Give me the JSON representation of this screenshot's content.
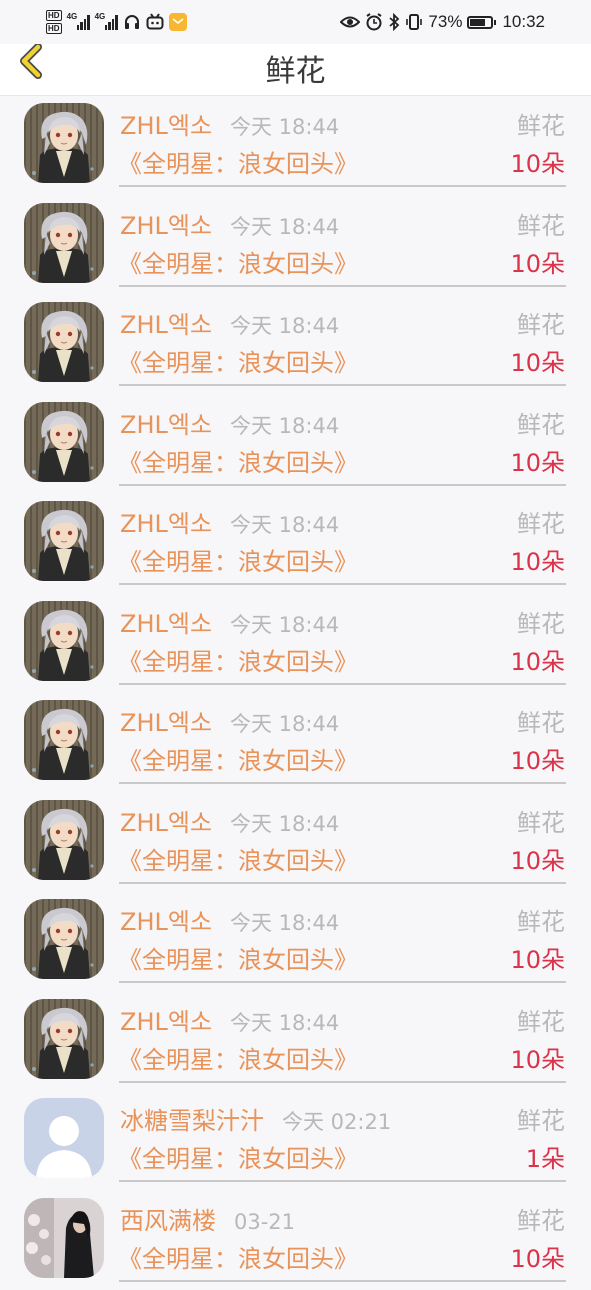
{
  "status_bar": {
    "hd1": "HD",
    "hd2": "HD",
    "net1": "4G",
    "net2": "4G",
    "battery_text": "73%",
    "battery_level": 0.73,
    "clock": "10:32"
  },
  "header": {
    "title": "鲜花"
  },
  "colors": {
    "name": "#e8935a",
    "count": "#d9344a",
    "muted": "#b8b8b8"
  },
  "records": [
    {
      "name": "ZHL엑소",
      "time": "今天 18:44",
      "gift": "鲜花",
      "book": "《全明星：浪女回头》",
      "count": "10朵",
      "avatar": "anime"
    },
    {
      "name": "ZHL엑소",
      "time": "今天 18:44",
      "gift": "鲜花",
      "book": "《全明星：浪女回头》",
      "count": "10朵",
      "avatar": "anime"
    },
    {
      "name": "ZHL엑소",
      "time": "今天 18:44",
      "gift": "鲜花",
      "book": "《全明星：浪女回头》",
      "count": "10朵",
      "avatar": "anime"
    },
    {
      "name": "ZHL엑소",
      "time": "今天 18:44",
      "gift": "鲜花",
      "book": "《全明星：浪女回头》",
      "count": "10朵",
      "avatar": "anime"
    },
    {
      "name": "ZHL엑소",
      "time": "今天 18:44",
      "gift": "鲜花",
      "book": "《全明星：浪女回头》",
      "count": "10朵",
      "avatar": "anime"
    },
    {
      "name": "ZHL엑소",
      "time": "今天 18:44",
      "gift": "鲜花",
      "book": "《全明星：浪女回头》",
      "count": "10朵",
      "avatar": "anime"
    },
    {
      "name": "ZHL엑소",
      "time": "今天 18:44",
      "gift": "鲜花",
      "book": "《全明星：浪女回头》",
      "count": "10朵",
      "avatar": "anime"
    },
    {
      "name": "ZHL엑소",
      "time": "今天 18:44",
      "gift": "鲜花",
      "book": "《全明星：浪女回头》",
      "count": "10朵",
      "avatar": "anime"
    },
    {
      "name": "ZHL엑소",
      "time": "今天 18:44",
      "gift": "鲜花",
      "book": "《全明星：浪女回头》",
      "count": "10朵",
      "avatar": "anime"
    },
    {
      "name": "ZHL엑소",
      "time": "今天 18:44",
      "gift": "鲜花",
      "book": "《全明星：浪女回头》",
      "count": "10朵",
      "avatar": "anime"
    },
    {
      "name": "冰糖雪梨汁汁",
      "time": "今天 02:21",
      "gift": "鲜花",
      "book": "《全明星：浪女回头》",
      "count": "1朵",
      "avatar": "default"
    },
    {
      "name": "西风满楼",
      "time": "03-21",
      "gift": "鲜花",
      "book": "《全明星：浪女回头》",
      "count": "10朵",
      "avatar": "photo"
    }
  ]
}
